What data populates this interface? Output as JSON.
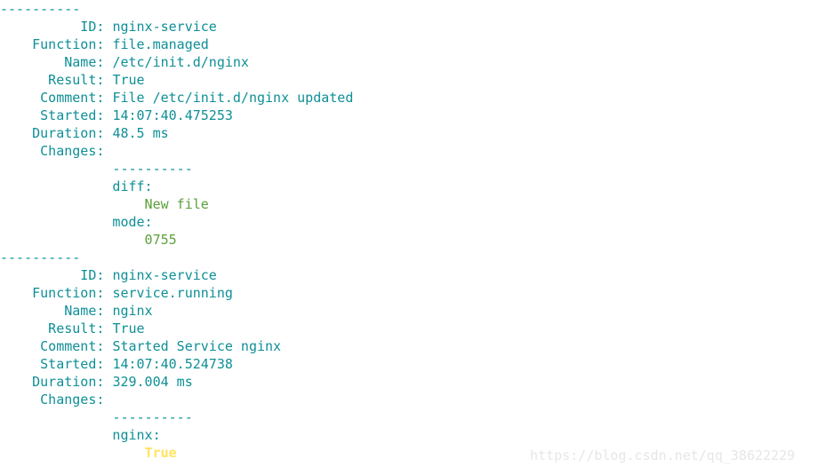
{
  "terminal": {
    "background_color": "#ffffff",
    "colors": {
      "teal": "#0e8f96",
      "green": "#5ba03a",
      "yellow": "#ffe45e",
      "watermark": "#e6e6e6"
    },
    "separator": "----------",
    "blocks": [
      {
        "separator": "----------",
        "fields": [
          {
            "label": "ID",
            "value": "nginx-service",
            "color": "teal"
          },
          {
            "label": "Function",
            "value": "file.managed",
            "color": "teal"
          },
          {
            "label": "Name",
            "value": "/etc/init.d/nginx",
            "color": "teal"
          },
          {
            "label": "Result",
            "value": "True",
            "color": "teal"
          },
          {
            "label": "Comment",
            "value": "File /etc/init.d/nginx updated",
            "color": "teal"
          },
          {
            "label": "Started",
            "value": "14:07:40.475253",
            "color": "teal"
          },
          {
            "label": "Duration",
            "value": "48.5 ms",
            "color": "teal"
          },
          {
            "label": "Changes",
            "value": "",
            "color": "teal"
          }
        ],
        "changes": {
          "separator": "----------",
          "entries": [
            {
              "key": "diff:",
              "value": "New file",
              "value_color": "green"
            },
            {
              "key": "mode:",
              "value": "0755",
              "value_color": "green"
            }
          ]
        }
      },
      {
        "separator": "----------",
        "fields": [
          {
            "label": "ID",
            "value": "nginx-service",
            "color": "teal"
          },
          {
            "label": "Function",
            "value": "service.running",
            "color": "teal"
          },
          {
            "label": "Name",
            "value": "nginx",
            "color": "teal"
          },
          {
            "label": "Result",
            "value": "True",
            "color": "teal"
          },
          {
            "label": "Comment",
            "value": "Started Service nginx",
            "color": "teal"
          },
          {
            "label": "Started",
            "value": "14:07:40.524738",
            "color": "teal"
          },
          {
            "label": "Duration",
            "value": "329.004 ms",
            "color": "teal"
          },
          {
            "label": "Changes",
            "value": "",
            "color": "teal"
          }
        ],
        "changes": {
          "separator": "----------",
          "entries": [
            {
              "key": "nginx:",
              "value": "True",
              "value_color": "yellow"
            }
          ]
        }
      }
    ]
  },
  "watermark": {
    "text": "https://blog.csdn.net/qq_38622229"
  }
}
